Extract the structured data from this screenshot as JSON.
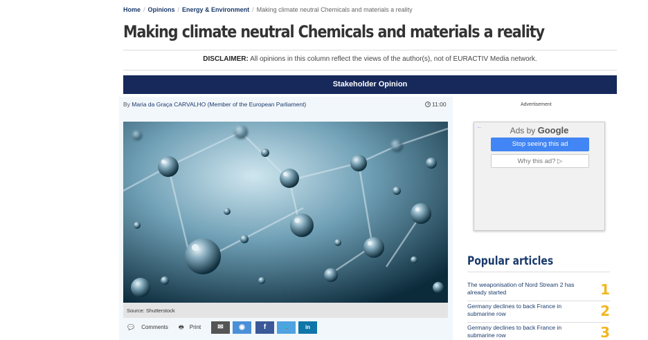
{
  "breadcrumb": {
    "home": "Home",
    "opinions": "Opinions",
    "section": "Energy & Environment",
    "current": "Making climate neutral Chemicals and materials a reality",
    "separator": "/"
  },
  "article": {
    "title": "Making climate neutral Chemicals and materials a reality",
    "disclaimer_label": "DISCLAIMER:",
    "disclaimer_text": "All opinions in this column reflect the views of the author(s), not of EURACTIV Media network.",
    "category_bar": "Stakeholder Opinion",
    "by": "By",
    "author": "Maria da Graça CARVALHO (Member of the European Parliament)",
    "time": "11:00",
    "image_caption": "Source: Shutterstock"
  },
  "share": {
    "comments_label": "Comments",
    "print_label": "Print",
    "email_glyph": "✉",
    "messenger_glyph": "◉",
    "facebook_glyph": "f",
    "twitter_glyph": "🐦",
    "linkedin_glyph": "in",
    "colors": {
      "email": "#555555",
      "messenger": "#4a90d9",
      "facebook": "#3b5998",
      "twitter": "#4fa3e0",
      "linkedin": "#0e76a8"
    }
  },
  "ad": {
    "label": "Advertisement",
    "back_glyph": "←",
    "ads_by": "Ads by",
    "google": "Google",
    "stop_button": "Stop seeing this ad",
    "why_button": "Why this ad? ▷"
  },
  "popular": {
    "title": "Popular articles",
    "items": [
      {
        "rank": "1",
        "title": "The weaponisation of Nord Stream 2 has already started"
      },
      {
        "rank": "2",
        "title": "Germany declines to back France in submarine row"
      },
      {
        "rank": "3",
        "title": "Germany declines to back France in submarine row"
      }
    ]
  },
  "colors": {
    "navy": "#17295b",
    "link": "#1a3a6b",
    "rank": "#f2b620"
  }
}
